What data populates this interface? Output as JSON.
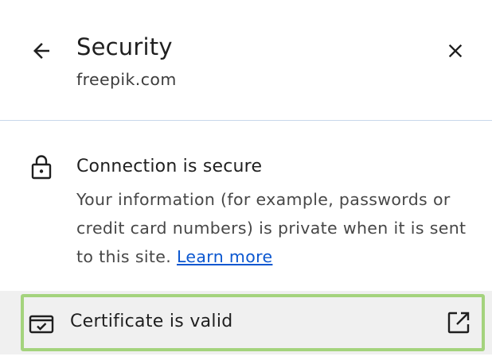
{
  "header": {
    "title": "Security",
    "subtitle": "freepik.com"
  },
  "connection": {
    "title": "Connection is secure",
    "description": "Your information (for example, passwords or credit card numbers) is private when it is sent to this site.",
    "learn_more_label": "Learn more"
  },
  "certificate": {
    "label": "Certificate is valid"
  },
  "icons": {
    "back": "arrow-left-icon",
    "close": "close-icon",
    "lock": "lock-icon",
    "certificate": "certificate-icon",
    "external": "external-link-icon"
  },
  "colors": {
    "link": "#0b57d0",
    "highlight": "#a4d37d",
    "divider": "#c8d7ea",
    "row_bg": "#f0f0f0"
  }
}
